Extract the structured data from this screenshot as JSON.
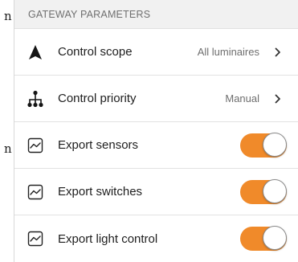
{
  "left_sliver": {
    "glyph_top": "n",
    "glyph_bottom": "n"
  },
  "section": {
    "title": "GATEWAY PARAMETERS"
  },
  "rows": [
    {
      "label": "Control scope",
      "value": "All luminaires",
      "icon": "navigation-arrow-icon"
    },
    {
      "label": "Control priority",
      "value": "Manual",
      "icon": "hierarchy-icon"
    },
    {
      "label": "Export sensors",
      "icon": "chart-line-icon",
      "toggle_on": true
    },
    {
      "label": "Export switches",
      "icon": "chart-line-icon",
      "toggle_on": true
    },
    {
      "label": "Export light control",
      "icon": "chart-line-icon",
      "toggle_on": true
    }
  ],
  "colors": {
    "toggle_on": "#f08a2a",
    "header_bg": "#f1f1f1",
    "divider": "#e2e2e2"
  }
}
